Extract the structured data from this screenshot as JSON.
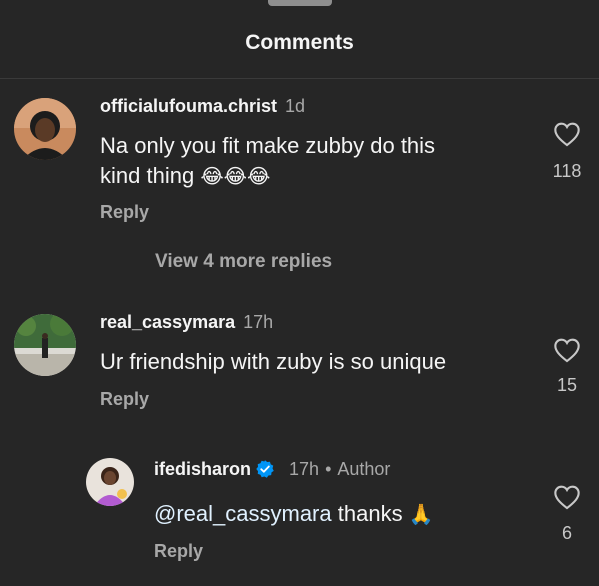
{
  "header": {
    "title": "Comments"
  },
  "comments": [
    {
      "username": "officialufouma.christ",
      "time": "1d",
      "text_line1": "Na only you fit make zubby do this",
      "text_line2": "kind thing",
      "emoji": "😂😂😂",
      "reply_label": "Reply",
      "likes": "118",
      "view_more": "View 4 more replies"
    },
    {
      "username": "real_cassymara",
      "time": "17h",
      "text": "Ur friendship with zuby is so unique",
      "reply_label": "Reply",
      "likes": "15"
    },
    {
      "username": "ifedisharon",
      "time": "17h",
      "author_label": "Author",
      "mention": "@real_cassymara",
      "text": "thanks",
      "emoji": "🙏",
      "reply_label": "Reply",
      "likes": "6"
    }
  ],
  "colors": {
    "background": "#262626",
    "verified": "#0095f6",
    "muted": "#a8a8a8"
  }
}
